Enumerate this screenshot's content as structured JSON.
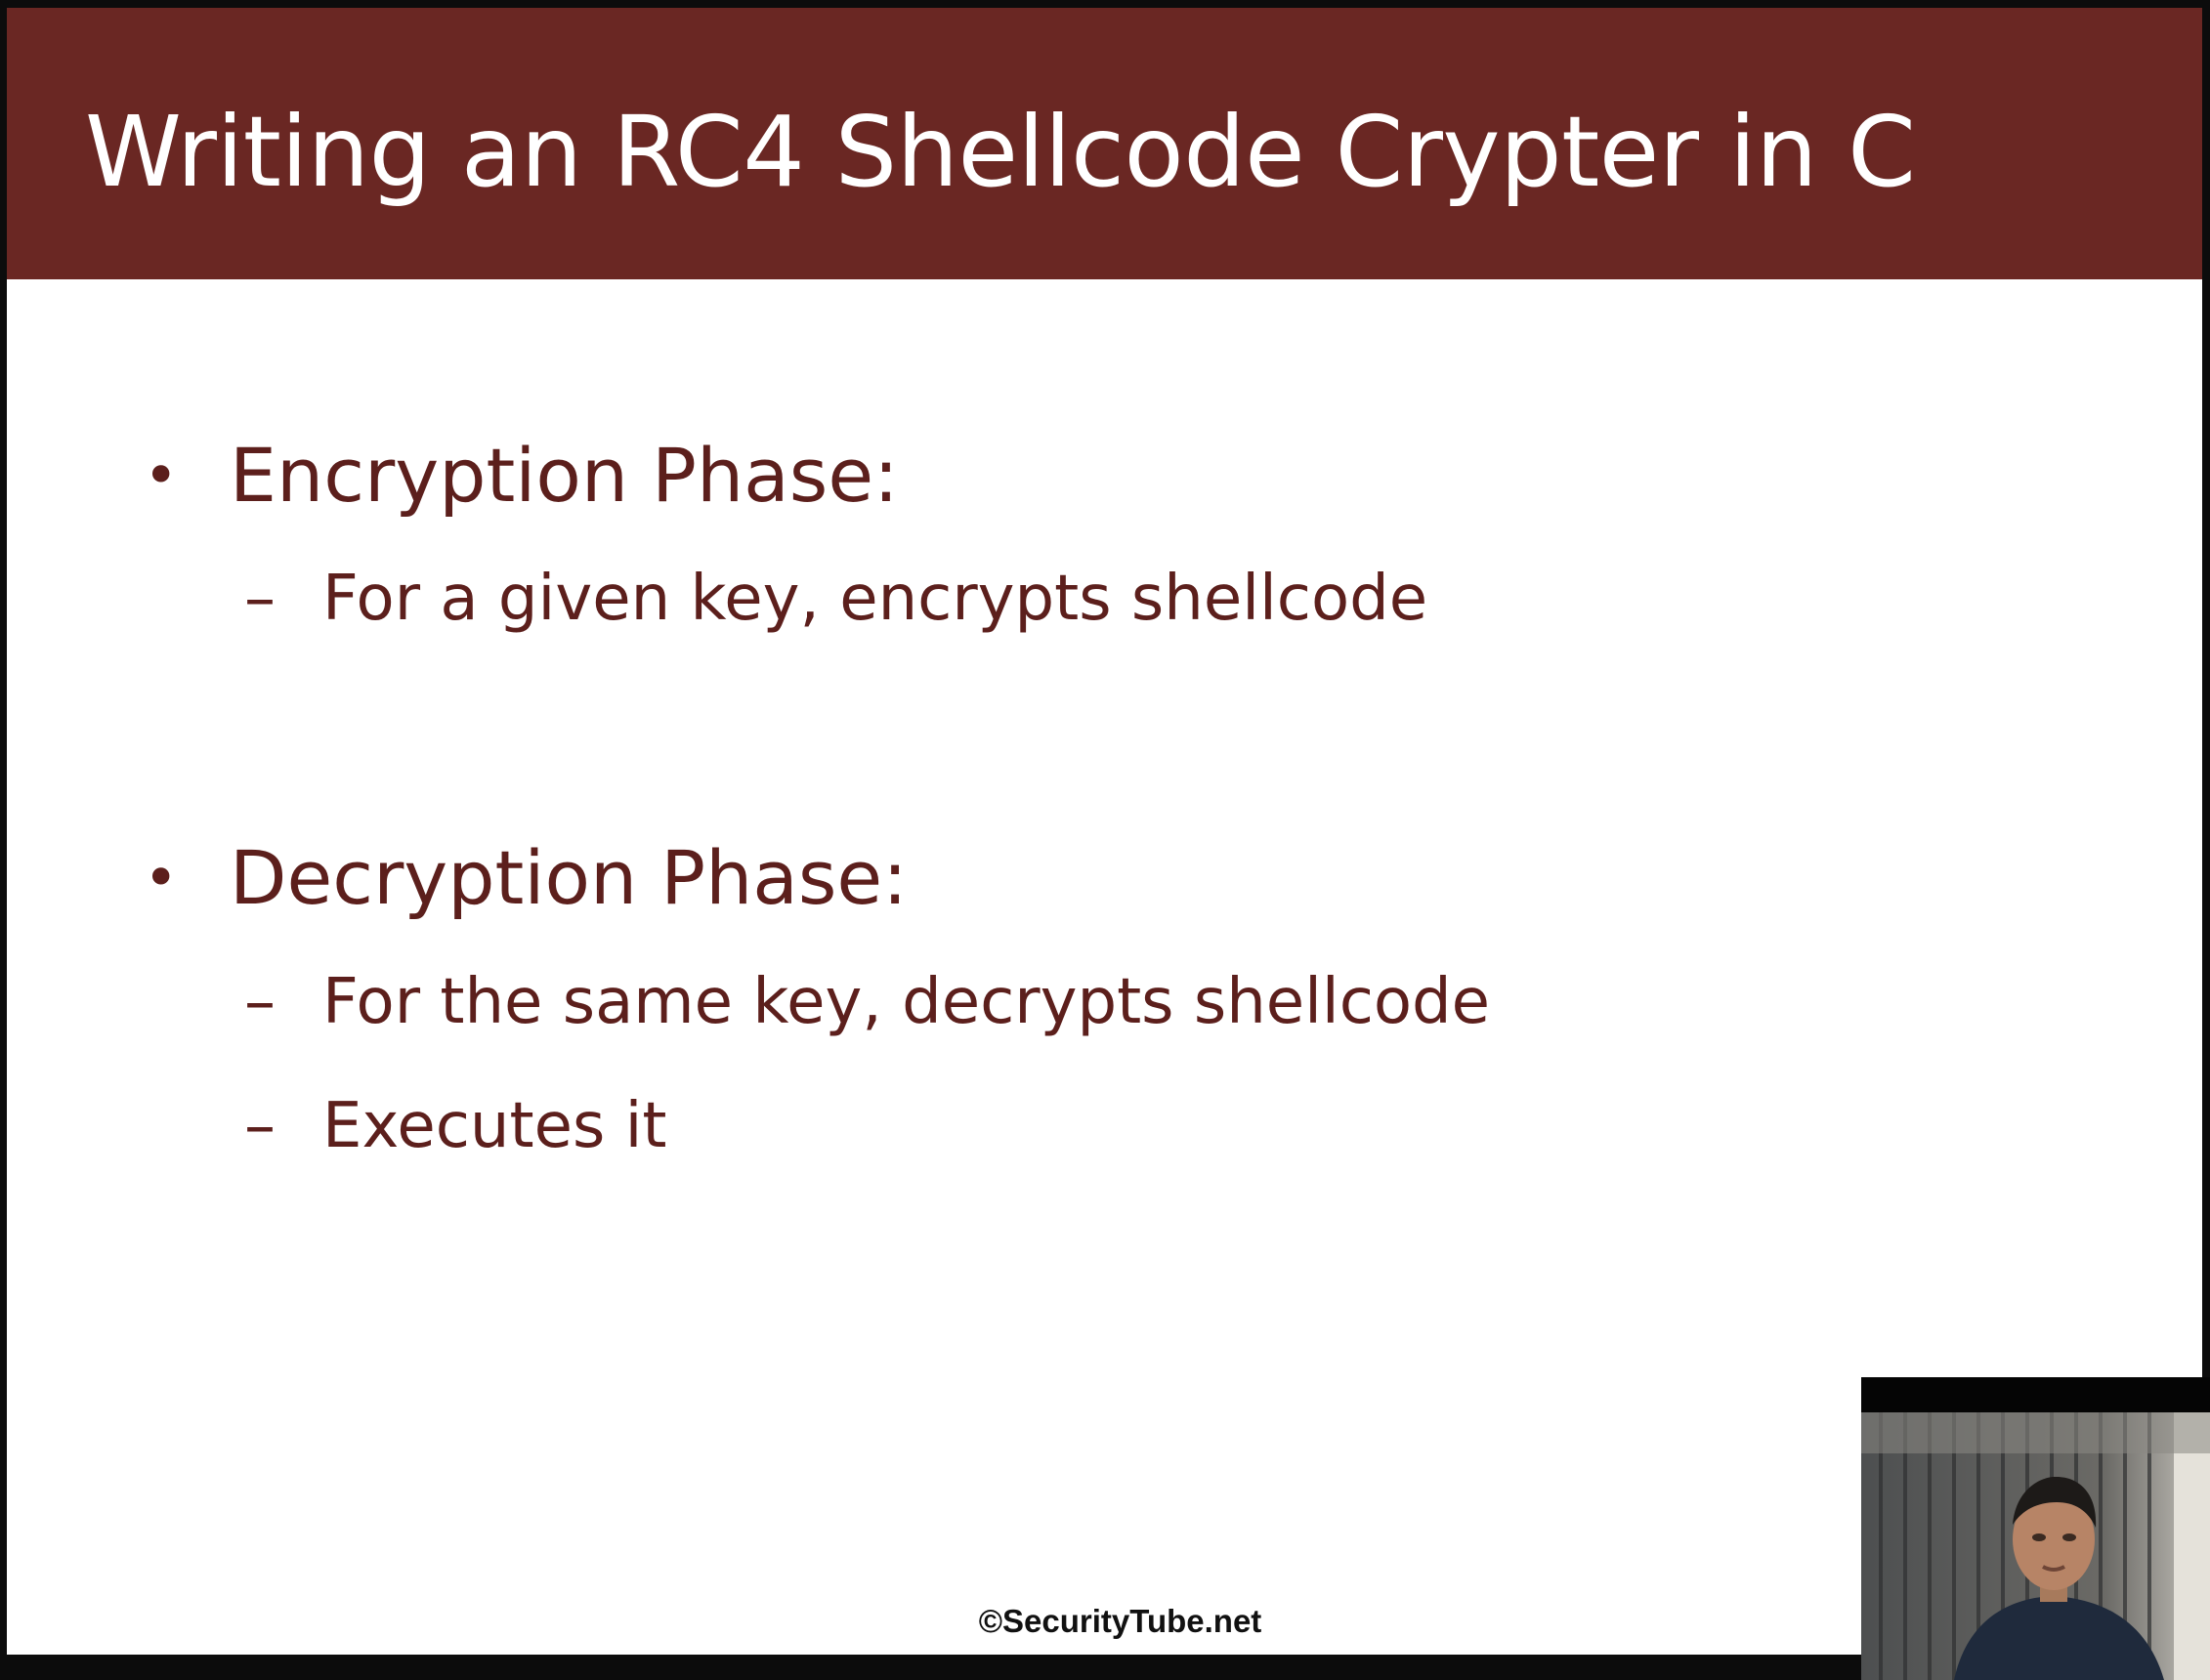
{
  "slide": {
    "title": "Writing an RC4 Shellcode Crypter in C",
    "bullets": [
      {
        "text": "Encryption Phase:",
        "subitems": [
          "For a given key, encrypts shellcode"
        ]
      },
      {
        "text": "Decryption Phase:",
        "subitems": [
          "For the same key, decrypts shellcode",
          "Executes it"
        ]
      }
    ],
    "bullet_glyph": "•",
    "sub_glyph": "–",
    "footer": "SecurityTube.net",
    "footer_symbol": "©"
  },
  "colors": {
    "title_bar": "#6a2723",
    "title_text": "#ffffff",
    "body_text": "#5c1f1c",
    "slide_bg": "#ffffff",
    "frame_bg": "#0c0c0c"
  },
  "webcam": {
    "icon": "presenter-webcam"
  }
}
